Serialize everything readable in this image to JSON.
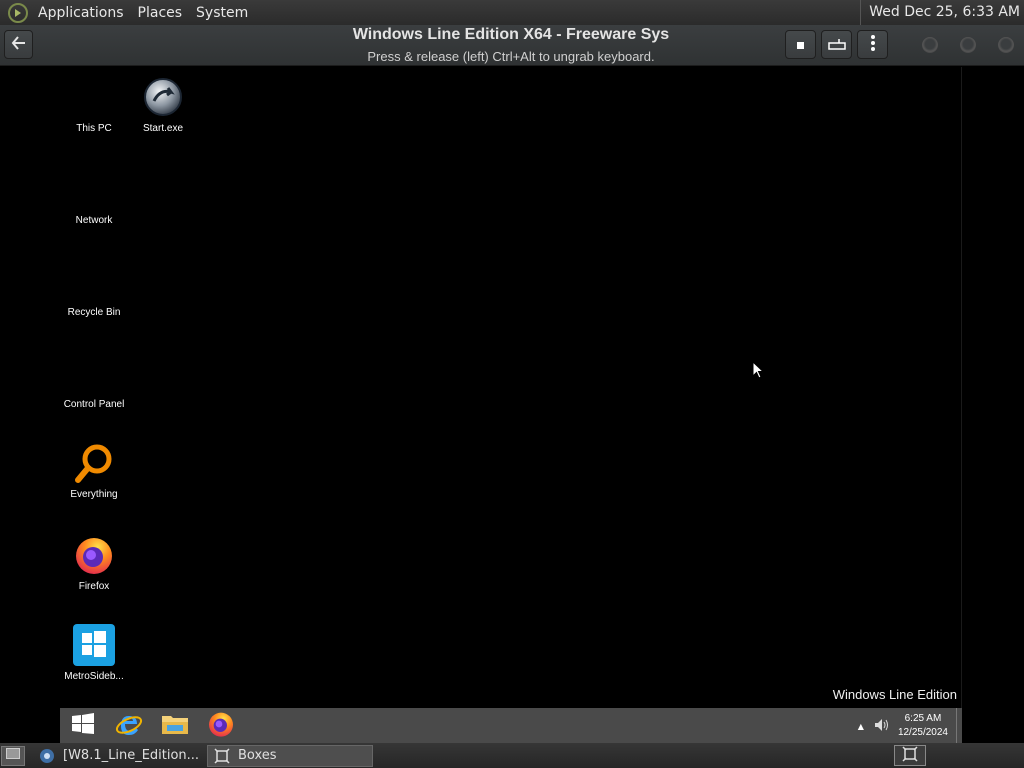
{
  "top_panel": {
    "menus": [
      "Applications",
      "Places",
      "System"
    ],
    "clock": "Wed Dec 25,  6:33 AM"
  },
  "header": {
    "title": "Windows Line Edition X64 - Freeware Sys",
    "subtitle": "Press & release (left) Ctrl+Alt to ungrab keyboard."
  },
  "desktop": {
    "icons": [
      {
        "label": "This PC",
        "icon": "this-pc-icon"
      },
      {
        "label": "Start.exe",
        "icon": "start-exe-icon"
      },
      {
        "label": "Network",
        "icon": "network-icon"
      },
      {
        "label": "Recycle Bin",
        "icon": "recycle-bin-icon"
      },
      {
        "label": "Control Panel",
        "icon": "control-panel-icon"
      },
      {
        "label": "Everything",
        "icon": "everything-search-icon"
      },
      {
        "label": "Firefox",
        "icon": "firefox-icon"
      },
      {
        "label": "MetroSideb...",
        "icon": "metro-sidebar-icon"
      }
    ],
    "watermark": "Windows Line Edition"
  },
  "win_taskbar": {
    "pinned": [
      "windows-start-icon",
      "internet-explorer-icon",
      "file-explorer-icon",
      "firefox-icon"
    ],
    "time": "6:25 AM",
    "date": "12/25/2024",
    "tray_arrow": "▲"
  },
  "bottom_panel": {
    "tasks": [
      {
        "label": "[W8.1_Line_Edition...",
        "icon": "vm-icon",
        "active": false
      },
      {
        "label": "Boxes",
        "icon": "boxes-icon",
        "active": true
      }
    ]
  },
  "colors": {
    "panel": "#2b2b2b",
    "taskbar": "#4a4a4a",
    "desktop": "#000000",
    "everything_orange": "#f08a00",
    "metro_blue": "#1ba1e2"
  }
}
